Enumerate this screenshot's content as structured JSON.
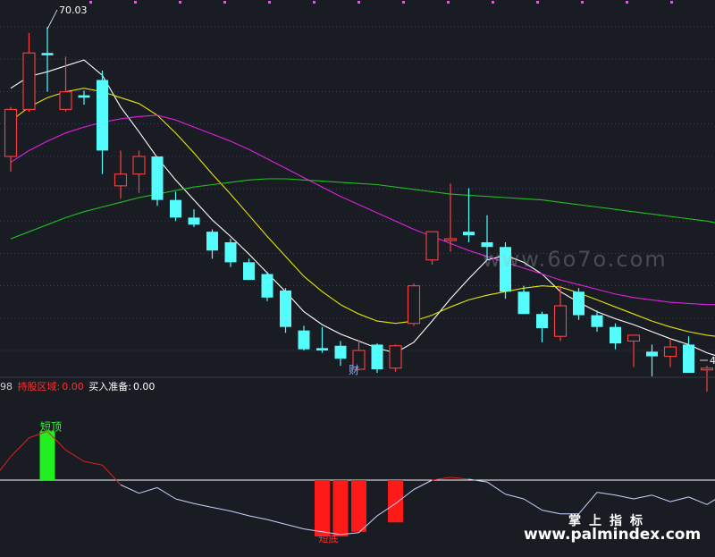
{
  "chart_data": [
    {
      "type": "candlestick",
      "title": "",
      "ylim": [
        42.5,
        72.0
      ],
      "high_label": "70.03",
      "low_label": "4",
      "annotation": "财",
      "candles": [
        {
          "o": 59.0,
          "h": 63.2,
          "l": 57.7,
          "c": 63.0
        },
        {
          "o": 63.0,
          "h": 69.5,
          "l": 62.8,
          "l2": 0,
          "c": 67.8
        },
        {
          "o": 67.8,
          "h": 70.0,
          "l": 64.5,
          "c": 67.6
        },
        {
          "o": 63.0,
          "h": 67.5,
          "l": 62.8,
          "c": 64.5
        },
        {
          "o": 64.2,
          "h": 64.6,
          "l": 63.4,
          "c": 64.0
        },
        {
          "o": 65.5,
          "h": 66.3,
          "l": 57.5,
          "c": 59.5
        },
        {
          "o": 56.5,
          "h": 59.5,
          "l": 55.4,
          "c": 57.5
        },
        {
          "o": 57.5,
          "h": 59.5,
          "l": 55.9,
          "c": 59.0
        },
        {
          "o": 59.0,
          "h": 59.0,
          "l": 54.8,
          "c": 55.3
        },
        {
          "o": 55.3,
          "h": 56.0,
          "l": 53.5,
          "c": 53.8
        },
        {
          "o": 53.8,
          "h": 54.5,
          "l": 53.0,
          "c": 53.2
        },
        {
          "o": 52.6,
          "h": 52.8,
          "l": 50.3,
          "c": 51.0
        },
        {
          "o": 51.7,
          "h": 52.0,
          "l": 49.6,
          "c": 50.0
        },
        {
          "o": 50.0,
          "h": 50.3,
          "l": 48.5,
          "c": 48.5
        },
        {
          "o": 49.0,
          "h": 49.2,
          "l": 46.7,
          "c": 47.0
        },
        {
          "o": 47.6,
          "h": 47.8,
          "l": 44.0,
          "c": 44.5
        },
        {
          "o": 44.2,
          "h": 44.6,
          "l": 42.5,
          "c": 42.6
        },
        {
          "o": 42.7,
          "h": 44.5,
          "l": 42.3,
          "c": 42.5
        },
        {
          "o": 42.9,
          "h": 43.3,
          "l": 41.2,
          "c": 41.8
        },
        {
          "o": 40.9,
          "h": 43.4,
          "l": 40.8,
          "c": 42.5
        },
        {
          "o": 43.0,
          "h": 43.1,
          "l": 40.6,
          "c": 40.9
        },
        {
          "o": 41.0,
          "h": 43.0,
          "l": 40.7,
          "c": 42.9
        },
        {
          "o": 44.8,
          "h": 48.2,
          "l": 44.6,
          "c": 48.0
        },
        {
          "o": 50.2,
          "h": 52.0,
          "l": 49.8,
          "c": 52.6
        },
        {
          "o": 51.9,
          "h": 56.7,
          "l": 50.9,
          "c": 52.0
        },
        {
          "o": 52.6,
          "h": 56.3,
          "l": 51.7,
          "c": 52.3
        },
        {
          "o": 51.7,
          "h": 54.0,
          "l": 50.2,
          "c": 51.3
        },
        {
          "o": 51.3,
          "h": 51.7,
          "l": 46.9,
          "c": 47.5
        },
        {
          "o": 47.5,
          "h": 48.0,
          "l": 45.6,
          "c": 45.6
        },
        {
          "o": 45.6,
          "h": 45.8,
          "l": 43.2,
          "c": 44.4
        },
        {
          "o": 43.7,
          "h": 48.0,
          "l": 43.3,
          "c": 46.3
        },
        {
          "o": 47.5,
          "h": 47.8,
          "l": 45.1,
          "c": 45.5
        },
        {
          "o": 45.5,
          "h": 45.9,
          "l": 44.1,
          "c": 44.5
        },
        {
          "o": 44.5,
          "h": 44.8,
          "l": 42.6,
          "c": 43.1
        },
        {
          "o": 43.3,
          "h": 43.8,
          "l": 41.1,
          "c": 43.8
        },
        {
          "o": 42.4,
          "h": 43.0,
          "l": 40.3,
          "c": 42.0
        },
        {
          "o": 42.0,
          "h": 43.5,
          "l": 41.1,
          "c": 42.8
        },
        {
          "o": 43.0,
          "h": 43.7,
          "l": 40.6,
          "c": 40.6
        },
        {
          "o": 40.9,
          "h": 41.2,
          "l": 39.0,
          "c": 41.0
        },
        {
          "o": 40.9,
          "h": 42.4,
          "l": 39.5,
          "c": 42.3
        }
      ],
      "series": [
        {
          "color": "#ffffff",
          "values": [
            64.8,
            65.8,
            66.2,
            66.7,
            67.2,
            65.9,
            63.2,
            61.1,
            58.9,
            57.0,
            55.3,
            53.6,
            52.2,
            50.7,
            49.1,
            47.5,
            45.8,
            44.7,
            43.9,
            43.3,
            42.7,
            42.3,
            43.2,
            45.0,
            46.9,
            48.6,
            50.2,
            50.6,
            50.0,
            49.0,
            47.5,
            46.6,
            45.8,
            45.2,
            44.7,
            44.1,
            43.5,
            43.0,
            42.3,
            41.8
          ]
        },
        {
          "color": "#e6e600",
          "values": [
            62.0,
            63.2,
            64.0,
            64.5,
            64.8,
            64.5,
            64.0,
            63.5,
            62.5,
            61.0,
            59.3,
            57.5,
            55.8,
            54.0,
            52.2,
            50.5,
            48.8,
            47.5,
            46.4,
            45.6,
            45.0,
            44.8,
            45.0,
            45.5,
            46.2,
            46.8,
            47.2,
            47.5,
            47.8,
            48.0,
            47.9,
            47.4,
            46.8,
            46.2,
            45.6,
            45.0,
            44.5,
            44.1,
            43.8,
            43.6
          ]
        },
        {
          "color": "#e020e0",
          "values": [
            58.5,
            59.5,
            60.3,
            61.0,
            61.5,
            61.9,
            62.2,
            62.4,
            62.5,
            62.1,
            61.5,
            60.9,
            60.3,
            59.6,
            58.8,
            58.0,
            57.2,
            56.4,
            55.6,
            54.9,
            54.2,
            53.5,
            52.8,
            52.2,
            51.6,
            51.0,
            50.5,
            50.0,
            49.5,
            49.0,
            48.5,
            48.1,
            47.7,
            47.3,
            47.0,
            46.8,
            46.6,
            46.5,
            46.4,
            46.4
          ]
        },
        {
          "color": "#20c020",
          "values": [
            52.0,
            52.6,
            53.2,
            53.8,
            54.3,
            54.7,
            55.1,
            55.5,
            55.8,
            56.1,
            56.4,
            56.6,
            56.8,
            57.0,
            57.1,
            57.1,
            57.0,
            56.9,
            56.8,
            56.7,
            56.6,
            56.4,
            56.2,
            56.0,
            55.8,
            55.7,
            55.6,
            55.5,
            55.4,
            55.3,
            55.1,
            54.9,
            54.7,
            54.5,
            54.3,
            54.1,
            53.9,
            53.7,
            53.5,
            53.2
          ]
        }
      ]
    },
    {
      "type": "indicator",
      "ylim": [
        -6.0,
        6.5
      ],
      "legend": [
        {
          "text": "98",
          "color": "#d0d0d0"
        },
        {
          "text": "持股区域:",
          "color": "#ff3030"
        },
        {
          "text": "0.00",
          "color": "#ff3030"
        },
        {
          "text": "买入准备:",
          "color": "#ffffff"
        },
        {
          "text": "0.00",
          "color": "#ffffff"
        }
      ],
      "top_label": "短顶",
      "bottom_label": "短底",
      "line": [
        0.0,
        2.5,
        4.5,
        5.2,
        3.2,
        2.0,
        1.6,
        -0.5,
        -1.4,
        -0.8,
        -2.0,
        -2.5,
        -2.9,
        -3.3,
        -3.8,
        -4.2,
        -4.7,
        -5.2,
        -5.5,
        -5.8,
        -5.6,
        -3.8,
        -2.5,
        -1.0,
        0.0,
        0.3,
        0.1,
        -0.2,
        -1.5,
        -2.0,
        -3.2,
        -3.6,
        -3.6,
        -1.3,
        -1.6,
        -2.0,
        -1.6,
        -2.3,
        -1.8,
        -2.6,
        -1.4
      ],
      "zero_line": 0,
      "top_bars": [
        {
          "index": 2,
          "value": 5.2
        }
      ],
      "bottom_bars": [
        {
          "index": 17,
          "value": -6.0
        },
        {
          "index": 18,
          "value": -6.0
        },
        {
          "index": 19,
          "value": -5.5
        },
        {
          "index": 21,
          "value": -4.5
        }
      ]
    }
  ],
  "watermarks": {
    "top": "www.6o7o.com",
    "bottom_cn": "掌上指标",
    "bottom_url": "www.palmindex.com"
  },
  "colors": {
    "up": "#ff4040",
    "down": "#54fcfc",
    "background": "#1a1c23",
    "grid": "#4a4a66",
    "top_marker": "#ff44ff"
  }
}
